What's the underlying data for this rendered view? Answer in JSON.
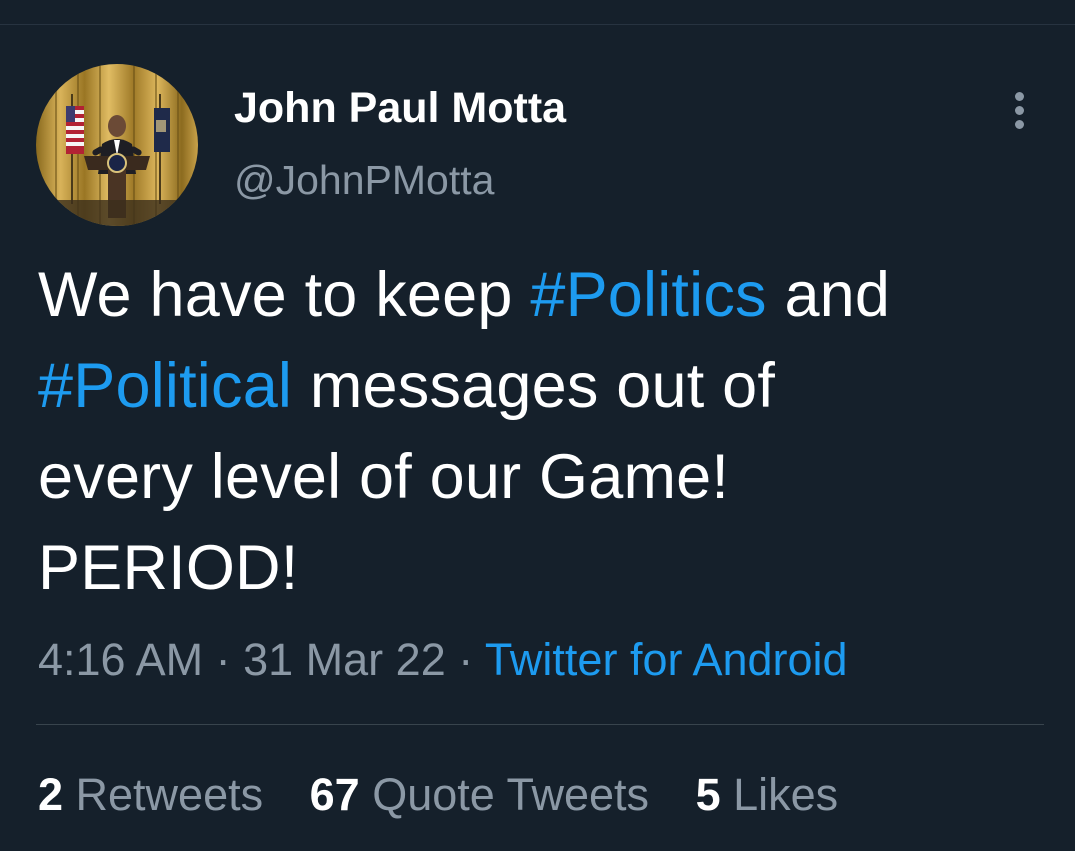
{
  "author": {
    "display_name": "John Paul Motta",
    "handle": "@JohnPMotta",
    "avatar_icon": "profile-photo"
  },
  "more_icon": "more-vertical-icon",
  "tweet": {
    "text_segments": [
      {
        "text": "We have to keep ",
        "hashtag": false
      },
      {
        "text": "#Politics",
        "hashtag": true
      },
      {
        "text": " and",
        "hashtag": false
      },
      {
        "text": "#Political",
        "hashtag": true
      },
      {
        "text": " messages out of",
        "hashtag": false
      },
      {
        "text": "every level of our Game!",
        "hashtag": false
      },
      {
        "text": "PERIOD!",
        "hashtag": false
      }
    ],
    "time": "4:16 AM",
    "separator": " · ",
    "date": "31 Mar 22",
    "source": "Twitter for Android"
  },
  "stats": {
    "retweets_count": "2",
    "retweets_label": " Retweets",
    "quotes_count": "67",
    "quotes_label": " Quote Tweets",
    "likes_count": "5",
    "likes_label": " Likes"
  },
  "colors": {
    "background": "#15202b",
    "text": "#ffffff",
    "secondary_text": "#8b98a5",
    "accent": "#1d9bf0",
    "divider": "#38444d"
  }
}
